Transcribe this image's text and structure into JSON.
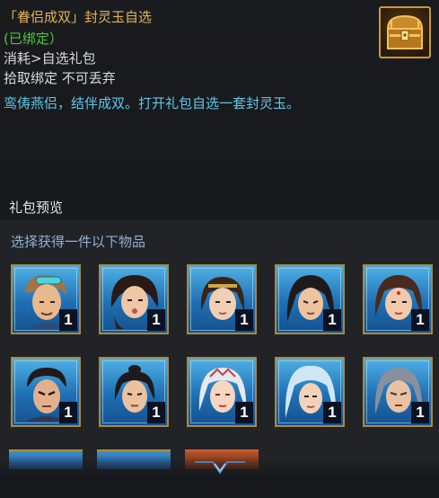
{
  "item": {
    "title": "「眷侣成双」封灵玉自选",
    "bound": "(已绑定）",
    "consume": "消耗>自选礼包",
    "bind_info": "拾取绑定 不可丢弃",
    "description": "鸾俦燕侣，结伴成双。打开礼包自选一套封灵玉。",
    "icon": "treasure-chest-icon"
  },
  "preview": {
    "title": "礼包预览",
    "select_label": "选择获得一件以下物品",
    "rows": [
      [
        {
          "icon": "male-portrait-goggles",
          "qty": "1"
        },
        {
          "icon": "female-portrait-surprised",
          "qty": "1"
        },
        {
          "icon": "female-portrait-headband",
          "qty": "1"
        },
        {
          "icon": "male-portrait-long-hair",
          "qty": "1"
        },
        {
          "icon": "female-portrait-forehead-mark",
          "qty": "1"
        }
      ],
      [
        {
          "icon": "male-portrait-warrior",
          "qty": "1"
        },
        {
          "icon": "male-portrait-topknot",
          "qty": "1"
        },
        {
          "icon": "female-portrait-white-hair",
          "qty": "1"
        },
        {
          "icon": "female-portrait-hood",
          "qty": "1"
        },
        {
          "icon": "male-portrait-grey-hair",
          "qty": "1"
        }
      ]
    ]
  },
  "colors": {
    "title": "#e2b356",
    "bound": "#49c83a",
    "description": "#5fc8e6",
    "frame_gold": "#a98a3c",
    "card_blue": "#1f6fb4"
  },
  "scroll": {
    "icon": "chevron-down-icon"
  }
}
